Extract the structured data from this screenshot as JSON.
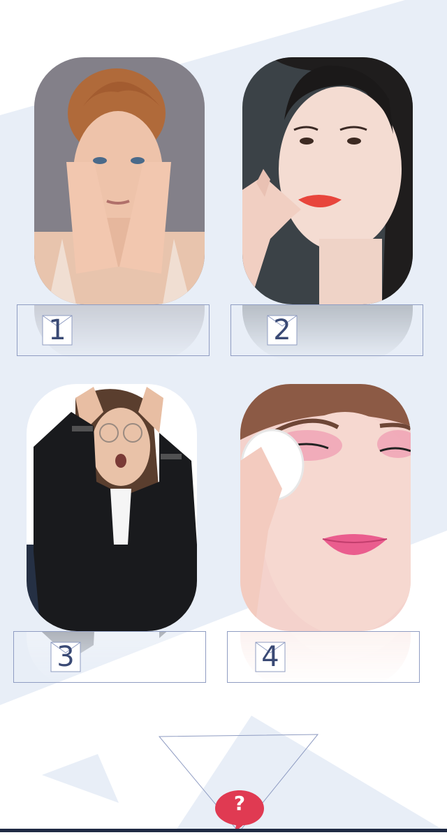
{
  "cards": [
    {
      "number": "1",
      "subject": "woman-hands-on-face"
    },
    {
      "number": "2",
      "subject": "woman-touching-lips"
    },
    {
      "number": "3",
      "subject": "stressed-woman-in-suit"
    },
    {
      "number": "4",
      "subject": "woman-removing-makeup"
    }
  ],
  "help": {
    "label": "?",
    "icon": "question-bubble-icon"
  },
  "colors": {
    "background_shape": "#e8eef7",
    "border": "#8f9cc2",
    "number_text": "#3a4a75",
    "help_bubble": "#e03a52",
    "bottom_bar": "#1f2a44"
  }
}
